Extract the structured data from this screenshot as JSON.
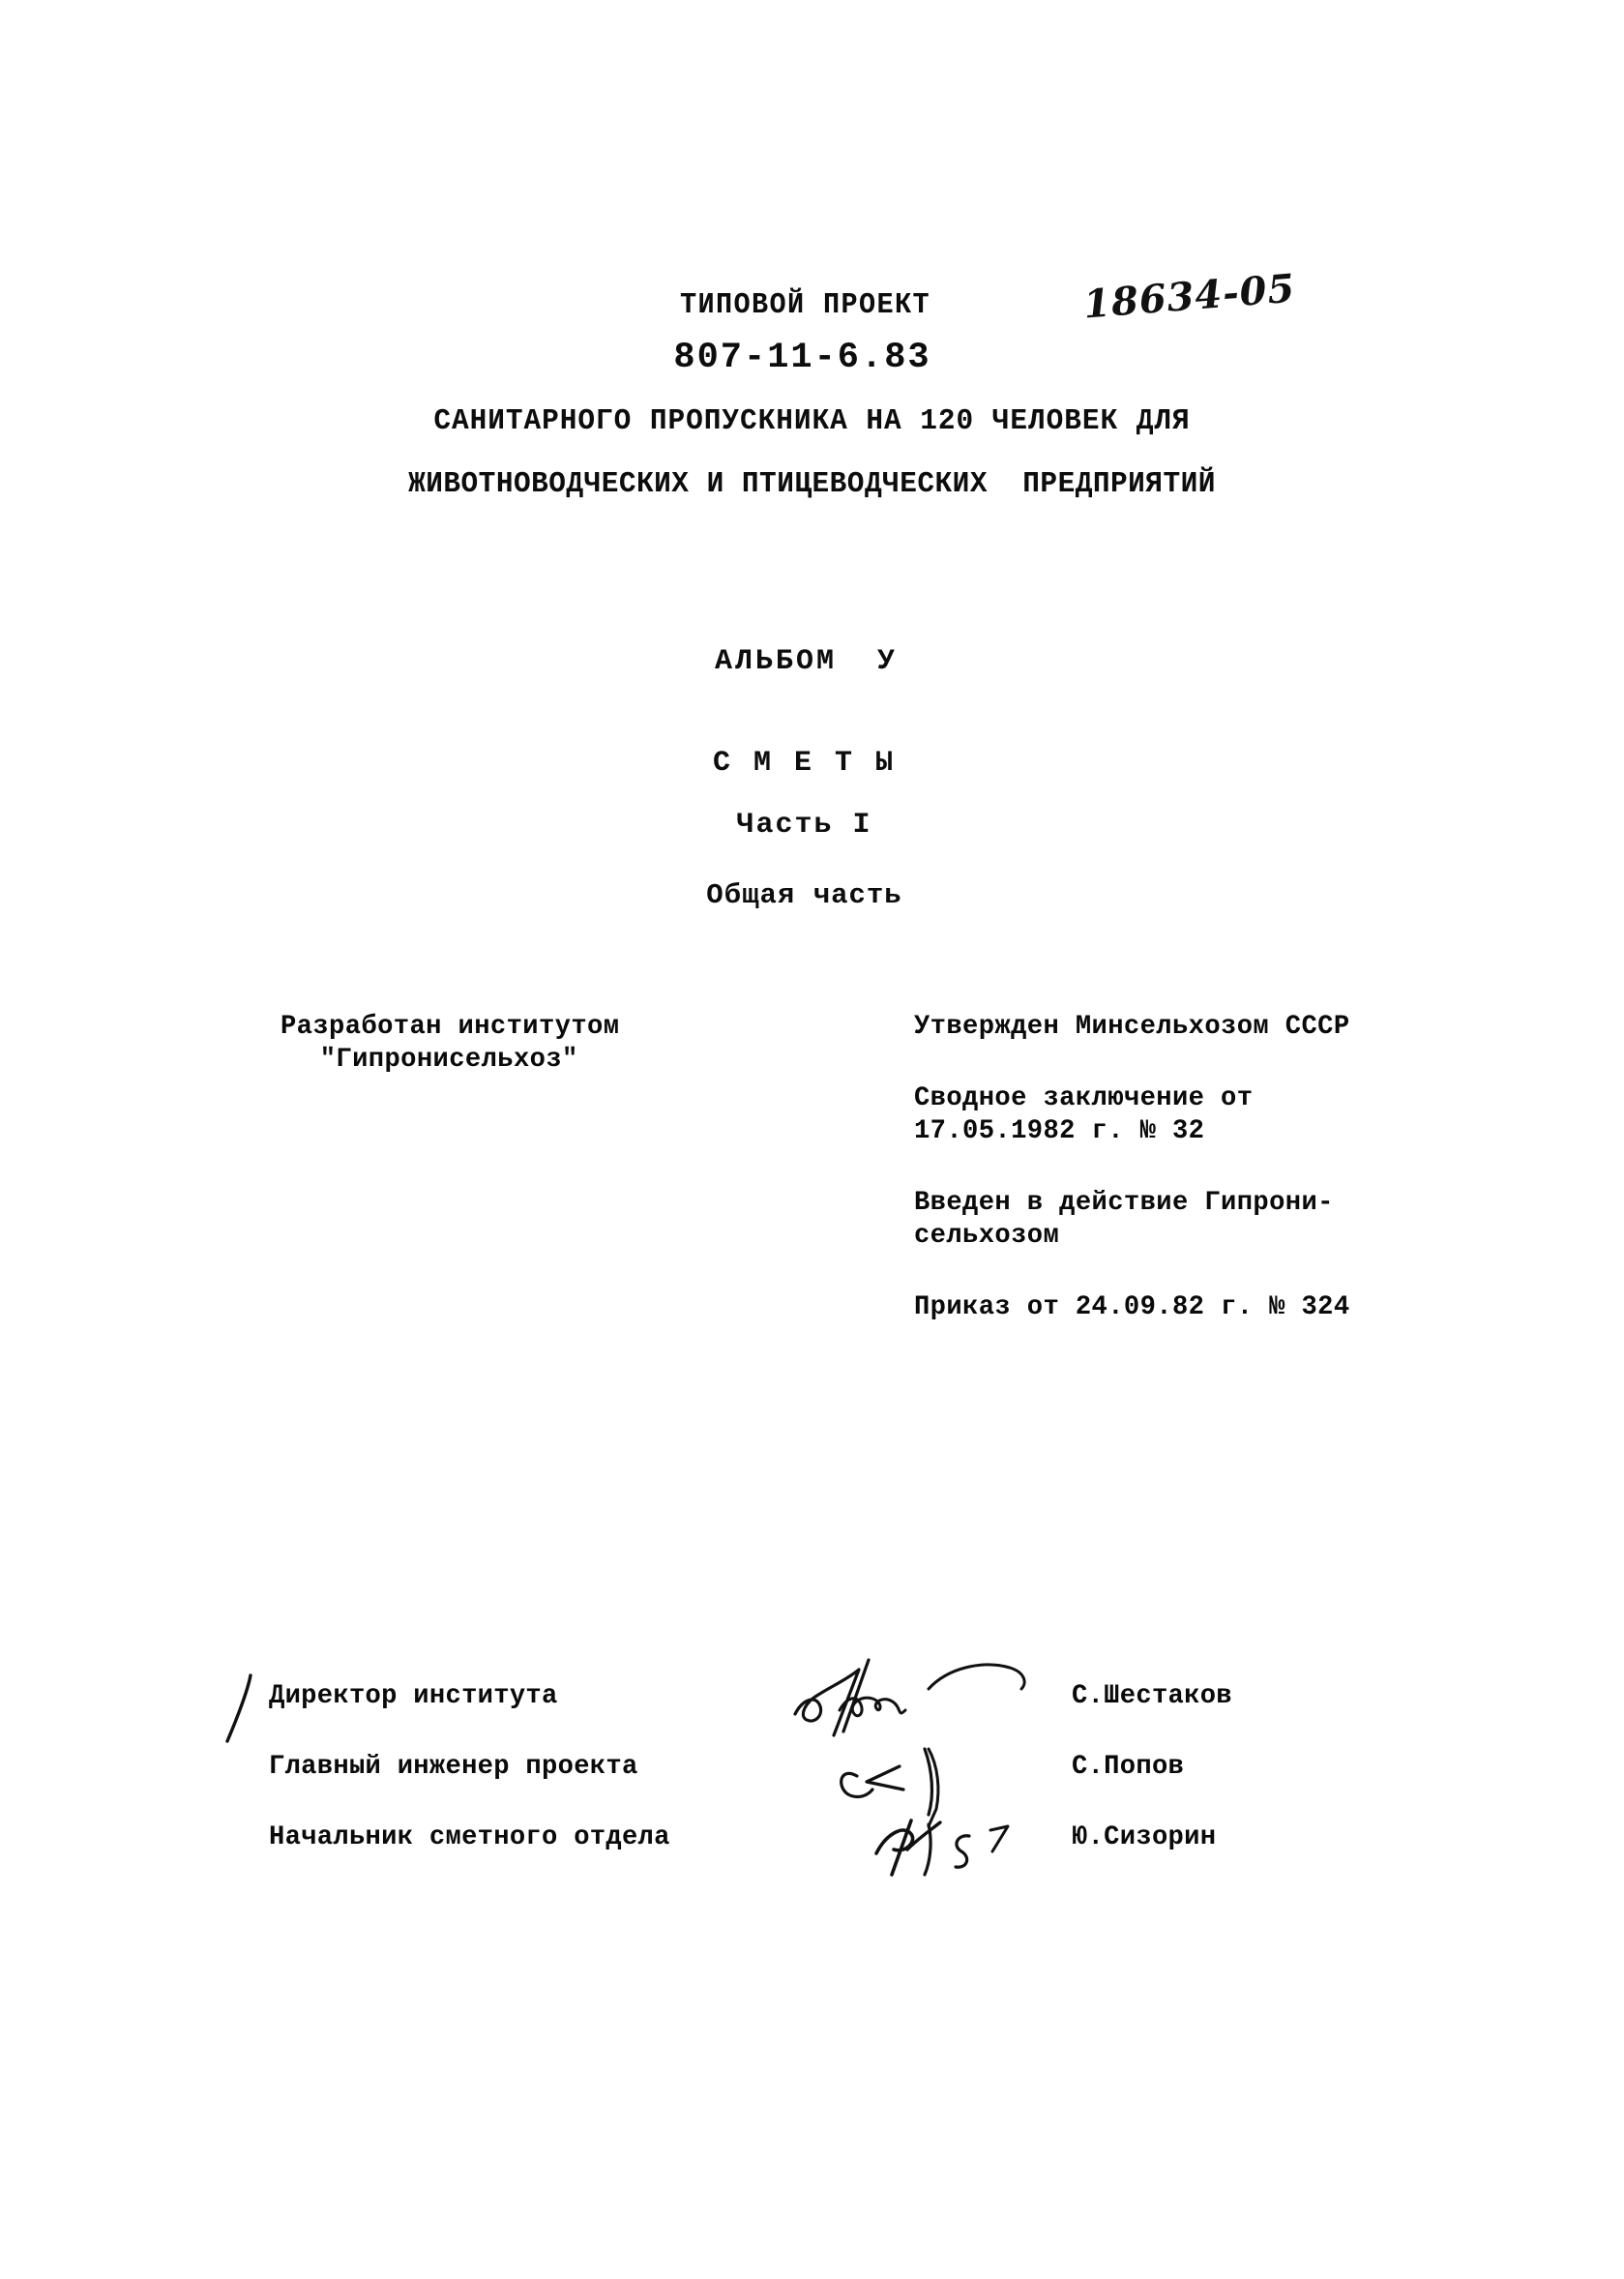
{
  "document": {
    "archive_number": "18634-05",
    "header": {
      "kicker": "ТИПОВОЙ ПРОЕКТ",
      "project_code": "807-11-6.83",
      "subtitle_line_1": "САНИТАРНОГО ПРОПУСКНИКА НА 120 ЧЕЛОВЕК ДЛЯ",
      "subtitle_line_2": "ЖИВОТНОВОДЧЕСКИХ И ПТИЦЕВОДЧЕСКИХ  ПРЕДПРИЯТИЙ"
    },
    "center": {
      "album": "АЛЬБОМ  У",
      "section_title": "С М Е Т Ы",
      "part": "Часть I",
      "part_subtitle": "Общая часть"
    },
    "approval": {
      "left": {
        "line_1": "Разработан институтом",
        "line_2": "\"Гипронисельхоз\""
      },
      "right": {
        "approved_by": "Утвержден Минсельхозом СССР",
        "conclusion_line_1": "Сводное заключение от",
        "conclusion_line_2": "17.05.1982 г. № 32",
        "enacted_line_1": "Введен в действие Гипрони-",
        "enacted_line_2": "сельхозом",
        "order_line": "Приказ от 24.09.82 г. № 324"
      }
    },
    "signatures": [
      {
        "role": "Директор института",
        "name": "С.Шестаков"
      },
      {
        "role": "Главный инженер проекта",
        "name": "С.Попов"
      },
      {
        "role": "Начальник сметного отдела",
        "name": "Ю.Сизорин"
      }
    ],
    "colors": {
      "page_background": "#ffffff",
      "ink": "#0d0d0d"
    }
  }
}
